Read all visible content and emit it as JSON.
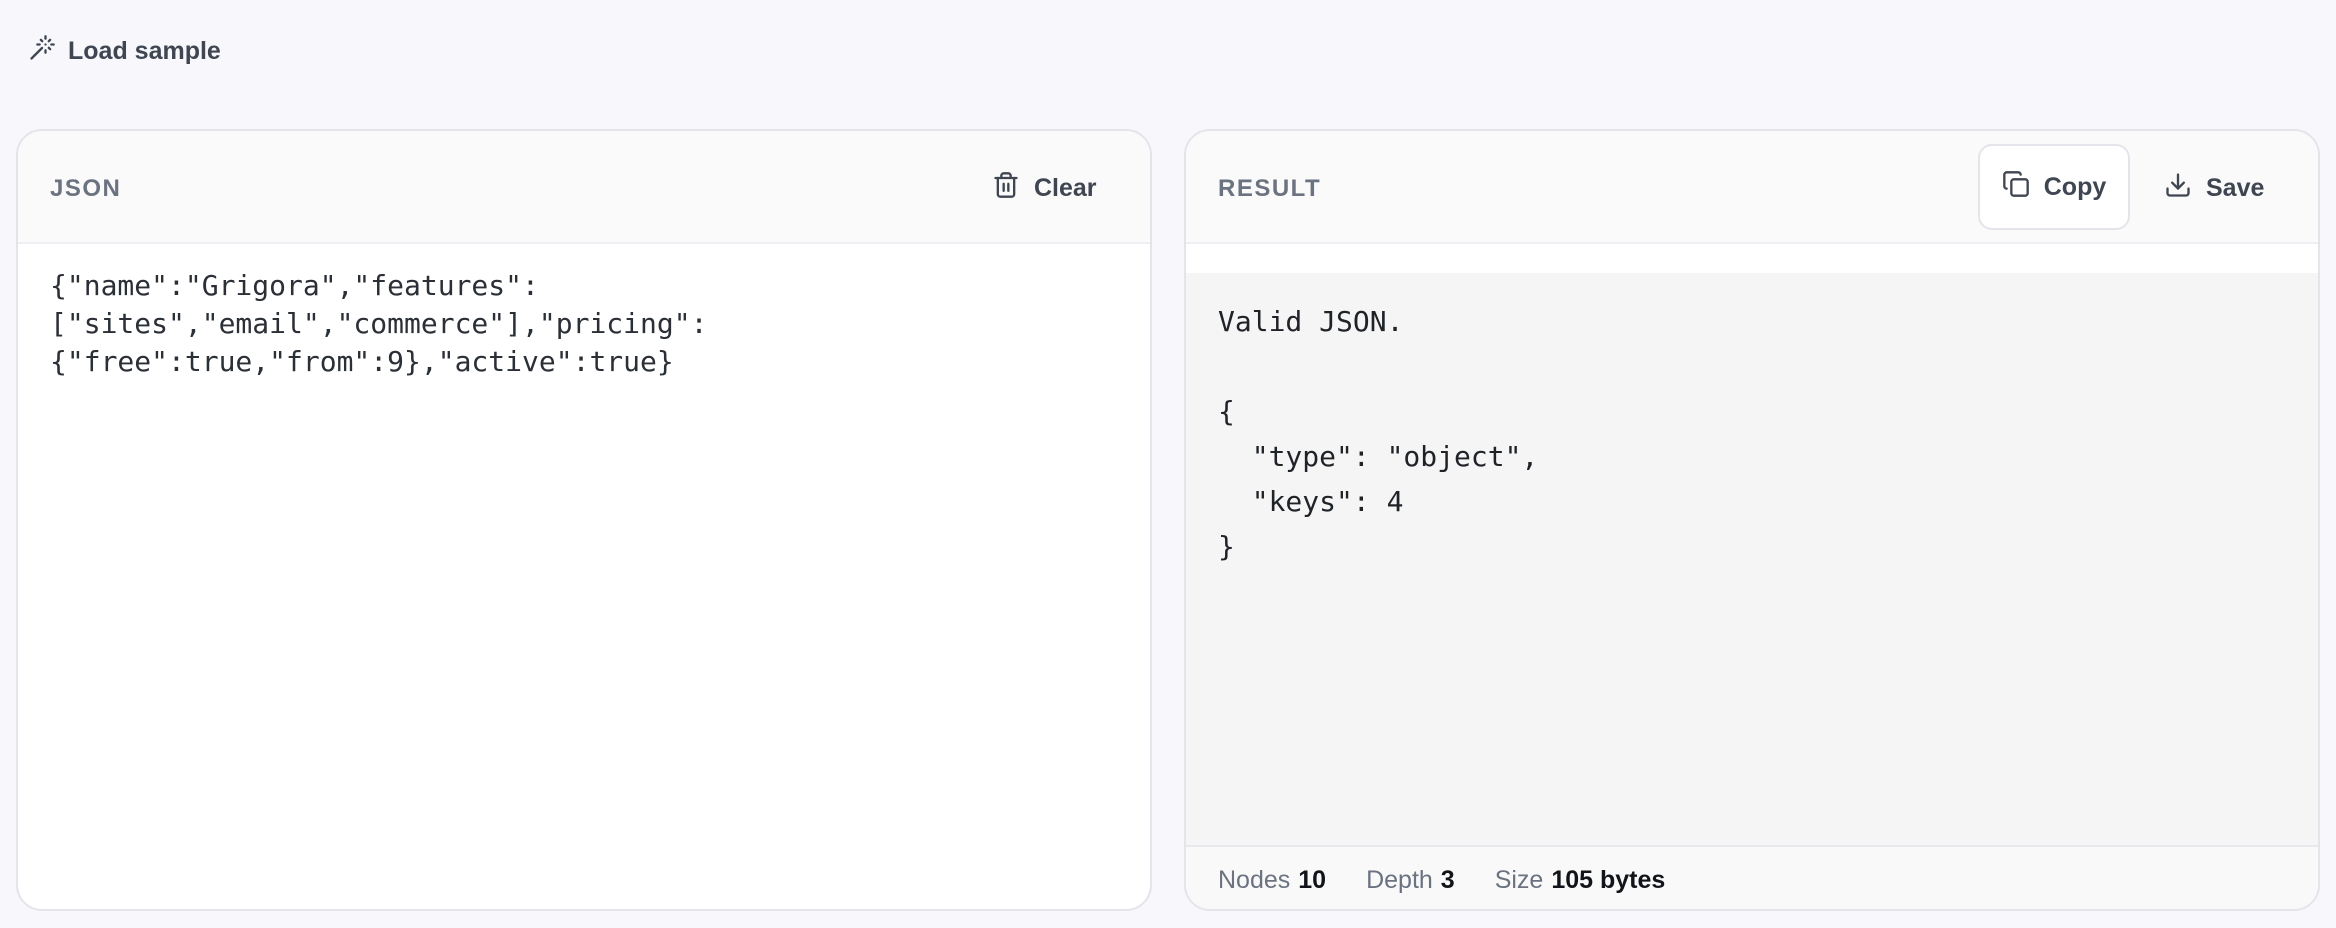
{
  "toolbar": {
    "load_sample_label": "Load sample",
    "load_sample_icon": "magic-wand-icon"
  },
  "input_panel": {
    "title": "JSON",
    "clear_label": "Clear",
    "clear_icon": "trash-icon",
    "content": "{\"name\":\"Grigora\",\"features\":\n[\"sites\",\"email\",\"commerce\"],\"pricing\":\n{\"free\":true,\"from\":9},\"active\":true}"
  },
  "result_panel": {
    "title": "RESULT",
    "copy_label": "Copy",
    "copy_icon": "copy-icon",
    "save_label": "Save",
    "save_icon": "download-icon",
    "output": "Valid JSON.\n\n{\n  \"type\": \"object\",\n  \"keys\": 4\n}"
  },
  "stats": {
    "nodes_label": "Nodes",
    "nodes_value": "10",
    "depth_label": "Depth",
    "depth_value": "3",
    "size_label": "Size",
    "size_value": "105 bytes"
  }
}
